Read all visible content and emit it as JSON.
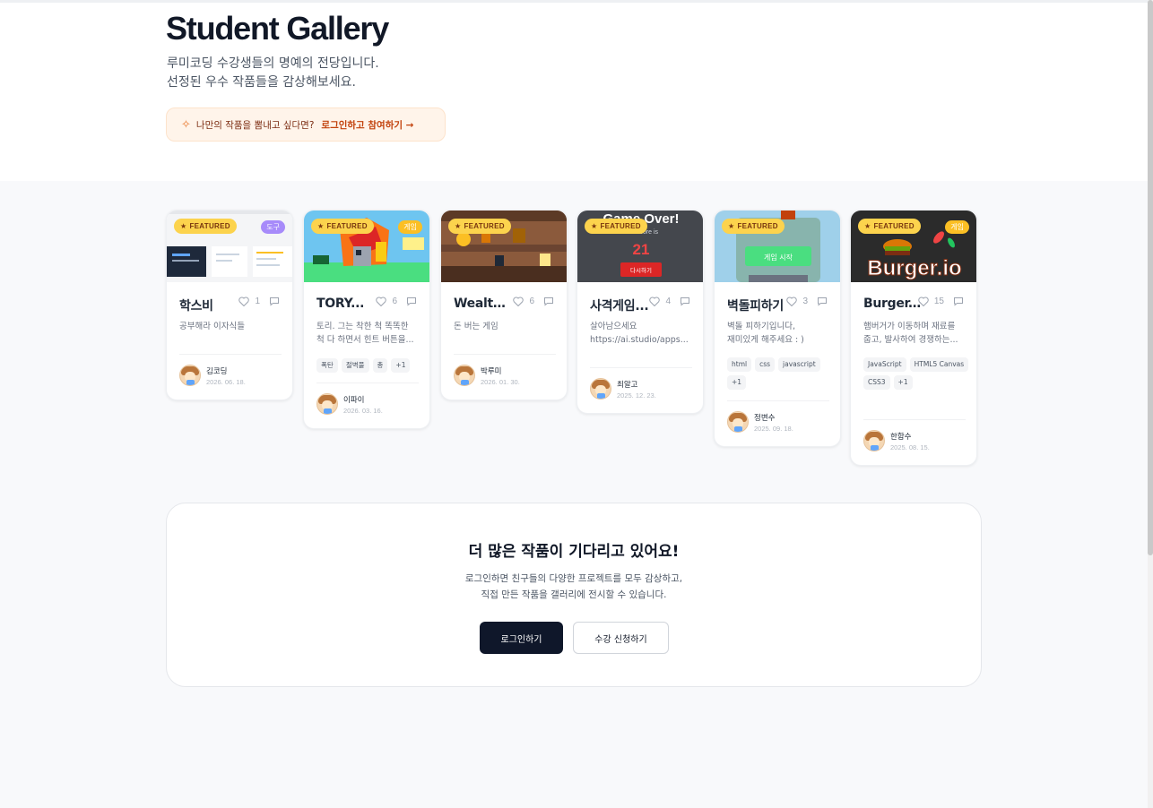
{
  "header": {
    "title": "Student Gallery",
    "subtitle_line1": "루미코딩 수강생들의 명예의 전당입니다.",
    "subtitle_line2": "선정된 우수 작품들을 감상해보세요.",
    "cta_question": "나만의 작품을 뽐내고 싶다면?",
    "cta_link": "로그인하고 참여하기 →"
  },
  "featured_label": "FEATURED",
  "cards": [
    {
      "title": "학스비",
      "likes": "1",
      "desc": [
        "공부해라 이자식들"
      ],
      "category": "도구",
      "category_color": "#a78bfa",
      "tags": [],
      "author": "김코딩",
      "date": "2026. 06. 18."
    },
    {
      "title": "TORY...",
      "likes": "6",
      "desc": [
        "토리. 그는 착한 척 똑똑한",
        "척 다 하면서 힌트 버튼을..."
      ],
      "category": "게임",
      "category_color": "#fbbf24",
      "tags": [
        "폭탄",
        "절벽풀",
        "총",
        "+1"
      ],
      "author": "이파이",
      "date": "2026. 03. 16."
    },
    {
      "title": "Wealth...",
      "likes": "6",
      "desc": [
        "돈 버는 게임"
      ],
      "category": "",
      "category_color": "",
      "tags": [],
      "author": "박루미",
      "date": "2026. 01. 30."
    },
    {
      "title": "사격게임...",
      "likes": "4",
      "desc": [
        "살아남으세요",
        "https://ai.studio/apps..."
      ],
      "category": "",
      "category_color": "",
      "tags": [],
      "author": "최알고",
      "date": "2025. 12. 23."
    },
    {
      "title": "벽돌피하기",
      "likes": "3",
      "desc": [
        "벽돌 피하기입니다,",
        "재미있게 해주세요 : )"
      ],
      "category": "",
      "category_color": "",
      "tags": [
        "html",
        "css",
        "javascript",
        "+1"
      ],
      "author": "정변수",
      "date": "2025. 09. 18."
    },
    {
      "title": "Burger.io",
      "likes": "15",
      "desc": [
        "햄버거가 이동하며 재료를",
        "줍고, 발사하여 경쟁하는..."
      ],
      "category": "게임",
      "category_color": "#fbbf24",
      "tags": [
        "JavaScript",
        "HTML5 Canvas",
        "CSS3",
        "+1"
      ],
      "author": "한함수",
      "date": "2025. 08. 15."
    }
  ],
  "thumbs": {
    "gameover_title": "Game Over!",
    "gameover_score_label": "score is",
    "gameover_score": "21",
    "gameover_button": "다시하기",
    "brick_button": "게임 시작",
    "burger_text": "Burger.io"
  },
  "more": {
    "title": "더 많은 작품이 기다리고 있어요!",
    "line1": "로그인하면 친구들의 다양한 프로젝트를 모두 감상하고,",
    "line2": "직접 만든 작품을 갤러리에 전시할 수 있습니다.",
    "login_button": "로그인하기",
    "enroll_button": "수강 신청하기"
  }
}
